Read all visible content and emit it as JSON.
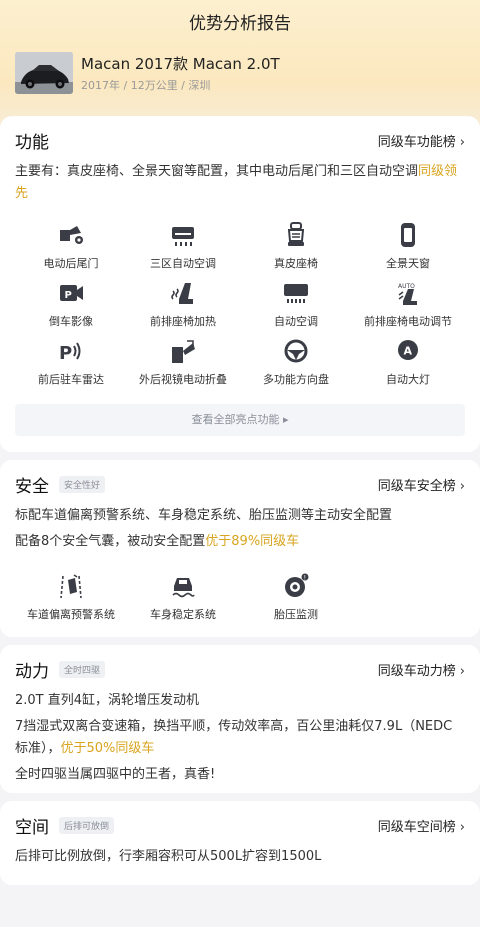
{
  "page": {
    "title": "优势分析报告"
  },
  "car": {
    "name": "Macan 2017款 Macan 2.0T",
    "meta": "2017年 / 12万公里 / 深圳"
  },
  "features": {
    "title": "功能",
    "rank_label": "同级车功能榜",
    "desc_main": "主要有：真皮座椅、全景天窗等配置，其中电动后尾门和三区自动空调",
    "desc_highlight": "同级领先",
    "items": [
      {
        "label": "电动后尾门",
        "icon": "tailgate-icon"
      },
      {
        "label": "三区自动空调",
        "icon": "ac-zone-icon"
      },
      {
        "label": "真皮座椅",
        "icon": "seat-icon"
      },
      {
        "label": "全景天窗",
        "icon": "sunroof-icon"
      },
      {
        "label": "倒车影像",
        "icon": "camera-icon"
      },
      {
        "label": "前排座椅加热",
        "icon": "seat-heat-icon"
      },
      {
        "label": "自动空调",
        "icon": "ac-icon"
      },
      {
        "label": "前排座椅电动调节",
        "icon": "seat-adjust-icon"
      },
      {
        "label": "前后驻车雷达",
        "icon": "parking-radar-icon"
      },
      {
        "label": "外后视镜电动折叠",
        "icon": "mirror-fold-icon"
      },
      {
        "label": "多功能方向盘",
        "icon": "steering-wheel-icon"
      },
      {
        "label": "自动大灯",
        "icon": "headlight-icon"
      }
    ],
    "more_label": "查看全部亮点功能 ▸"
  },
  "safety": {
    "title": "安全",
    "tag": "安全性好",
    "rank_label": "同级车安全榜",
    "line1": "标配车道偏离预警系统、车身稳定系统、胎压监测等主动安全配置",
    "line2_main": "配备8个安全气囊，被动安全配置",
    "line2_highlight": "优于89%同级车",
    "items": [
      {
        "label": "车道偏离预警系统",
        "icon": "lane-departure-icon"
      },
      {
        "label": "车身稳定系统",
        "icon": "stability-icon"
      },
      {
        "label": "胎压监测",
        "icon": "tire-pressure-icon"
      }
    ]
  },
  "power": {
    "title": "动力",
    "tag": "全时四驱",
    "rank_label": "同级车动力榜",
    "line1": "2.0T 直列4缸，涡轮增压发动机",
    "line2_main": "7挡湿式双离合变速箱，换挡平顺，传动效率高，百公里油耗仅7.9L（NEDC标准），",
    "line2_highlight": "优于50%同级车",
    "line3": "全时四驱当属四驱中的王者，真香!"
  },
  "space": {
    "title": "空间",
    "tag": "后排可放倒",
    "rank_label": "同级车空间榜",
    "line1": "后排可比例放倒，行李厢容积可从500L扩容到1500L"
  },
  "colors": {
    "accent": "#d9a520",
    "header_bg": "#fbe8bf",
    "icon": "#3a3d45"
  }
}
